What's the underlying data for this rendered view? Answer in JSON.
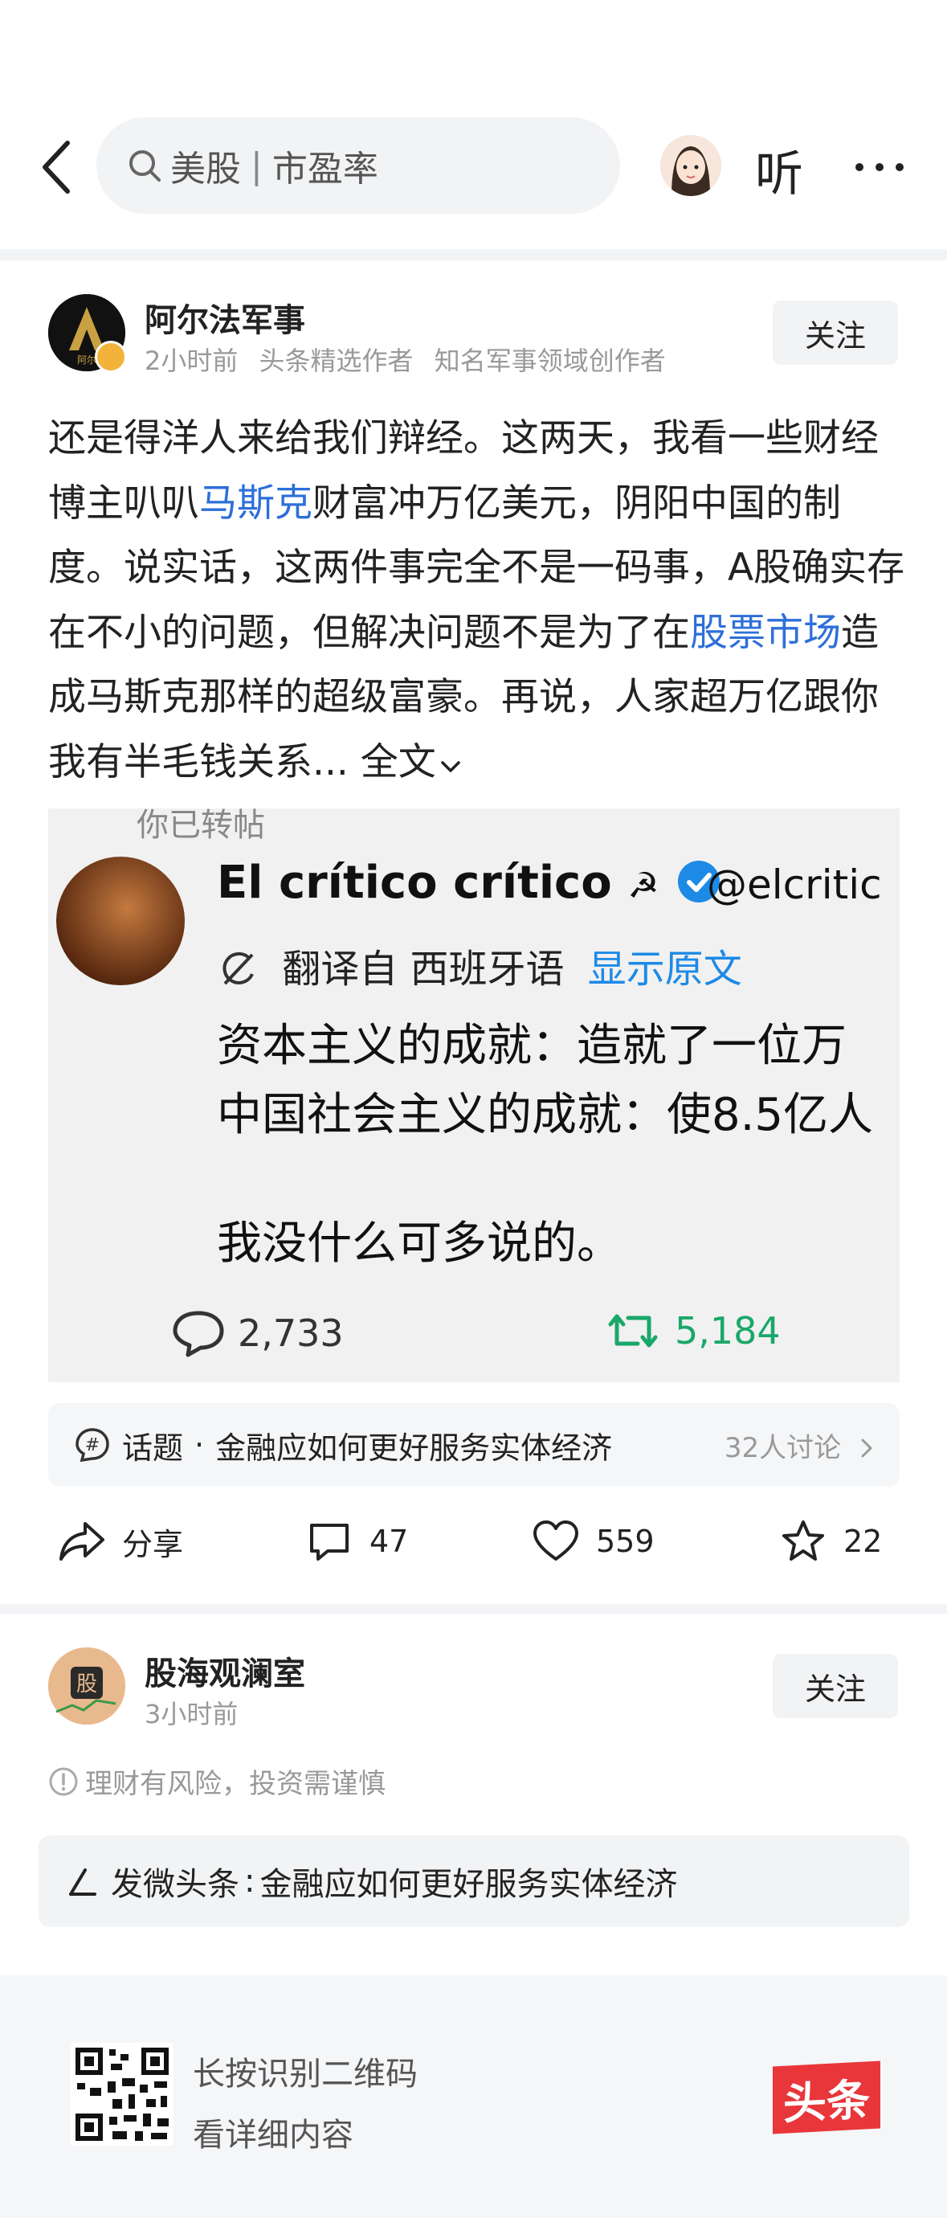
{
  "header": {
    "search_keyword": "美股",
    "search_separator": "|",
    "search_suggestion": "市盈率",
    "listen_label": "听"
  },
  "post1": {
    "author": "阿尔法军事",
    "avatar_text": "阿尔",
    "time": "2小时前",
    "badge1": "头条精选作者",
    "badge2": "知名军事领域创作者",
    "follow_label": "关注",
    "text_part1": "还是得洋人来给我们辩经。这两天，我看一些财经博主叭叭",
    "link1": "马斯克",
    "text_part2": "财富冲万亿美元，阴阳中国的制度。说实话，这两件事完全不是一码事，A股确实存在不小的问题，但解决问题不是为了在",
    "link2": "股票市场",
    "text_part3": "造成马斯克那样的超级富豪。再说，人家超万亿跟你我有半毛钱关系...",
    "expand_label": "全文",
    "image": {
      "cutoff_text": "你已转帖",
      "name": "El crítico crítico",
      "hammer": "☭",
      "handle": "@elcritic",
      "translated_from": "翻译自 西班牙语",
      "show_original": "显示原文",
      "line1": "资本主义的成就：造就了一位万",
      "line2": "中国社会主义的成就：使8.5亿人",
      "line3": "我没什么可多说的。",
      "replies": "2,733",
      "retweets": "5,184"
    },
    "topic": {
      "prefix": "话题",
      "dot": "·",
      "title": "金融应如何更好服务实体经济",
      "count": "32人讨论"
    },
    "actions": {
      "share": "分享",
      "comments": "47",
      "likes": "559",
      "favorites": "22"
    }
  },
  "post2": {
    "author": "股海观澜室",
    "avatar_text": "股",
    "time": "3小时前",
    "follow_label": "关注",
    "risk_notice": "理财有风险，投资需谨慎",
    "compose_label": "发微头条",
    "compose_topic": "金融应如何更好服务实体经济"
  },
  "footer": {
    "qr_line1": "长按识别二维码",
    "qr_line2": "看详细内容",
    "logo_text": "头条"
  },
  "colors": {
    "link": "#2d6fd9",
    "logo_red": "#e8363a",
    "retweet_green": "#1aa86a",
    "verified_blue": "#1d8ae6"
  }
}
